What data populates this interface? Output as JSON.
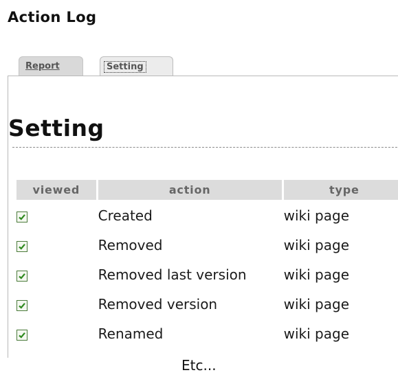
{
  "page": {
    "title": "Action Log"
  },
  "tabs": [
    {
      "label": "Report",
      "active": false
    },
    {
      "label": "Setting",
      "active": true
    }
  ],
  "section": {
    "heading": "Setting"
  },
  "table": {
    "headers": {
      "viewed": "viewed",
      "action": "action",
      "type": "type"
    },
    "rows": [
      {
        "viewed": true,
        "action": "Created",
        "type": "wiki page"
      },
      {
        "viewed": true,
        "action": "Removed",
        "type": "wiki page"
      },
      {
        "viewed": true,
        "action": "Removed last version",
        "type": "wiki page"
      },
      {
        "viewed": true,
        "action": "Removed version",
        "type": "wiki page"
      },
      {
        "viewed": true,
        "action": "Renamed",
        "type": "wiki page"
      }
    ]
  },
  "footer": {
    "note": "Etc..."
  },
  "colors": {
    "checkmark": "#2f8a1f",
    "header_bg": "#dcdcdc"
  }
}
